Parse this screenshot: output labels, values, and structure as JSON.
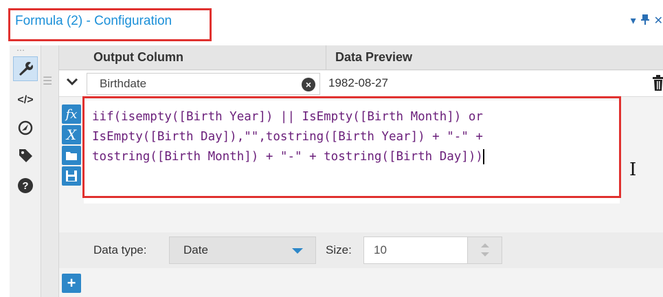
{
  "window": {
    "title": "Formula (2) - Configuration",
    "controls": [
      "▾",
      "📌",
      "✕"
    ]
  },
  "toolbar": {
    "grip": "⋯",
    "tools": [
      {
        "icon": "wrench-icon"
      },
      {
        "icon": "code-icon",
        "glyph": "</>"
      },
      {
        "icon": "navigate-icon"
      },
      {
        "icon": "tag-icon"
      },
      {
        "icon": "help-icon",
        "glyph": "?"
      }
    ]
  },
  "grid": {
    "headers": {
      "output_column": "Output Column",
      "data_preview": "Data Preview"
    },
    "row": {
      "output_column": "Birthdate",
      "data_preview": "1982-08-27"
    }
  },
  "editor": {
    "side_buttons": [
      {
        "icon": "function-icon",
        "glyph": "fx"
      },
      {
        "icon": "variable-icon",
        "glyph": "X"
      },
      {
        "icon": "open-icon"
      },
      {
        "icon": "save-icon"
      }
    ],
    "lines": [
      "iif(isempty([Birth Year]) || IsEmpty([Birth Month]) or",
      "IsEmpty([Birth Day]),\"\",tostring([Birth Year]) + \"-\" +",
      "tostring([Birth Month]) + \"-\" + tostring([Birth Day]))"
    ]
  },
  "field_settings": {
    "data_type_label": "Data type:",
    "data_type_value": "Date",
    "size_label": "Size:",
    "size_value": "10"
  },
  "actions": {
    "add_label": "+"
  },
  "colors": {
    "accent": "#2d87c8",
    "highlight": "#e0312f",
    "title": "#1a8fd8"
  }
}
